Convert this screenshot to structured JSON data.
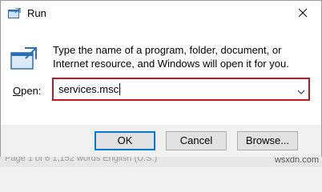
{
  "window": {
    "title": "Run"
  },
  "icons": {
    "app": "run-app-icon",
    "big": "run-large-icon",
    "close": "close-icon",
    "dropdown": "chevron-down-icon"
  },
  "description": "Type the name of a program, folder, document, or Internet resource, and Windows will open it for you.",
  "open": {
    "label_prefix": "",
    "label_accel": "O",
    "label_rest": "pen:",
    "value": "services.msc"
  },
  "buttons": {
    "ok": "OK",
    "cancel": "Cancel",
    "browse": "Browse..."
  },
  "background": {
    "status_text": "Page 1 of 6    1,152 words    English (U.S.)",
    "watermark": "wsxdn.com"
  },
  "colors": {
    "highlight_border": "#c4161c",
    "accent": "#0078d7"
  }
}
